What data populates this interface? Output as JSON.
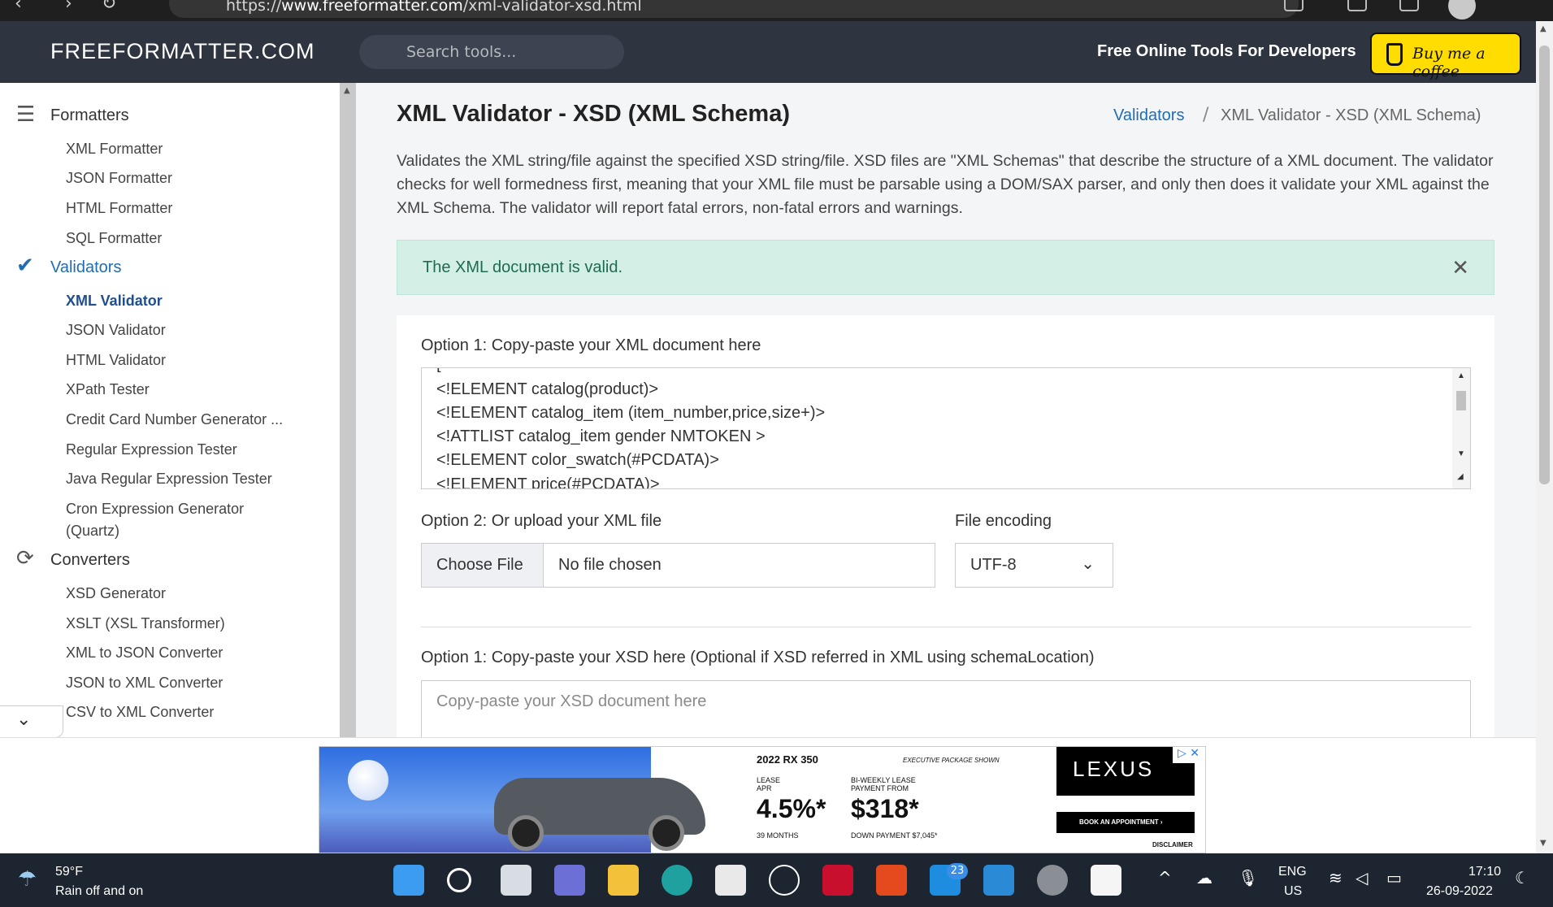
{
  "browser": {
    "url_prefix": "https://",
    "url_domain": "www.freeformatter.com",
    "url_path": "/xml-validator-xsd.html"
  },
  "header": {
    "brand": "FREEFORMATTER.COM",
    "search_placeholder": "Search tools...",
    "tagline": "Free Online Tools For Developers",
    "coffee_label": "Buy me a coffee"
  },
  "sidebar": {
    "sections": [
      {
        "label": "Formatters",
        "icon": "indent-icon",
        "items": [
          "XML Formatter",
          "JSON Formatter",
          "HTML Formatter",
          "SQL Formatter"
        ]
      },
      {
        "label": "Validators",
        "icon": "double-check-icon",
        "items": [
          "XML Validator",
          "JSON Validator",
          "HTML Validator",
          "XPath Tester",
          "Credit Card Number Generator ...",
          "Regular Expression Tester",
          "Java Regular Expression Tester",
          "Cron Expression Generator",
          "(Quartz)"
        ]
      },
      {
        "label": "Converters",
        "icon": "refresh-icon",
        "items": [
          "XSD Generator",
          "XSLT (XSL Transformer)",
          "XML to JSON Converter",
          "JSON to XML Converter",
          "CSV to XML Converter"
        ]
      }
    ],
    "active_item": "XML Validator"
  },
  "main": {
    "title": "XML Validator - XSD (XML Schema)",
    "breadcrumb_link": "Validators",
    "breadcrumb_separator": "/",
    "breadcrumb_current": "XML Validator - XSD (XML Schema)",
    "description": "Validates the XML string/file against the specified XSD string/file. XSD files are \"XML Schemas\" that describe the structure of a XML document. The validator checks for well formedness first, meaning that your XML file must be parsable using a DOM/SAX parser, and only then does it validate your XML against the XML Schema. The validator will report fatal errors, non-fatal errors and warnings.",
    "alert_text": "The XML document is valid.",
    "option1_label": "Option 1: Copy-paste your XML document here",
    "xml_lines": [
      "[",
      "<!ELEMENT catalog(product)>",
      "<!ELEMENT catalog_item (item_number,price,size+)>",
      "<!ATTLIST catalog_item gender NMTOKEN >",
      "<!ELEMENT color_swatch(#PCDATA)>",
      "<!ELEMENT price(#PCDATA)>"
    ],
    "option2_label": "Option 2: Or upload your XML file",
    "choose_file": "Choose File",
    "no_file": "No file chosen",
    "encoding_label": "File encoding",
    "encoding_value": "UTF-8",
    "xsd_label": "Option 1: Copy-paste your XSD here (Optional if XSD referred in XML using schemaLocation)",
    "xsd_placeholder": "Copy-paste your XSD document here"
  },
  "ad": {
    "model": "2022 RX 350",
    "package": "EXECUTIVE PACKAGE SHOWN",
    "lease_apr_label": "LEASE\nAPR",
    "apr": "4.5%*",
    "months": "39 MONTHS",
    "payment_label": "BI-WEEKLY LEASE\nPAYMENT FROM",
    "payment": "$318*",
    "down": "DOWN PAYMENT $7,045*",
    "brand": "LEXUS",
    "cta": "BOOK AN APPOINTMENT ›",
    "disclaimer": "DISCLAIMER"
  },
  "taskbar": {
    "temperature": "59°F",
    "weather": "Rain off and on",
    "badge": "23",
    "lang1": "ENG",
    "lang2": "US",
    "time": "17:10",
    "date": "26-09-2022"
  }
}
